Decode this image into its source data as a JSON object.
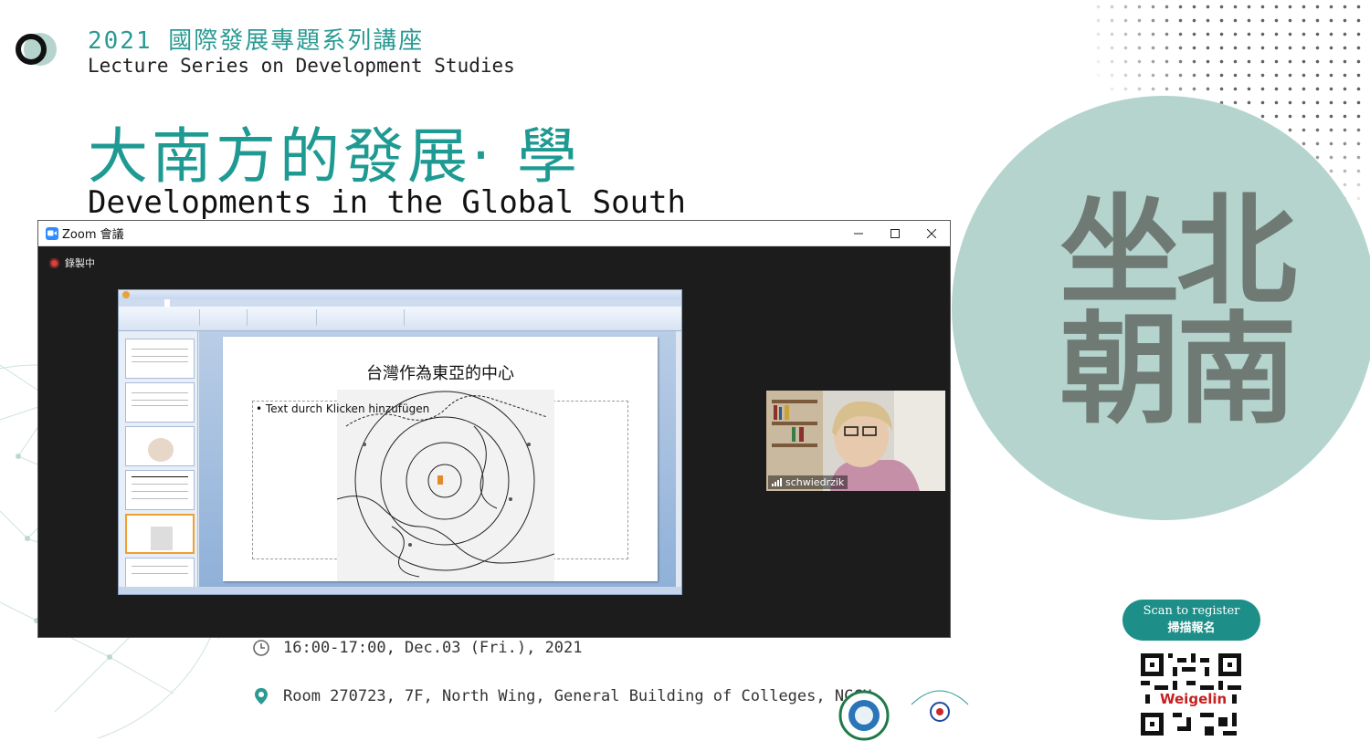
{
  "poster": {
    "series_cn": "2021 國際發展專題系列講座",
    "series_en": "Lecture Series on Development Studies",
    "title_cn": "大南方的發展‧ 學",
    "title_en": "Developments in the Global South",
    "side_calligraphy": [
      "坐北",
      "朝南"
    ],
    "time": "16:00-17:00, Dec.03 (Fri.), 2021",
    "location": "Room 270723, 7F, North Wing, General Building of Colleges, NCCU",
    "scan_en": "Scan to register",
    "scan_cn": "掃描報名",
    "qr_label": "Weigelin",
    "accent_color": "#1f9a93",
    "circle_color": "#b4d4cd"
  },
  "zoom": {
    "window_title": "Zoom 會議",
    "recording_label": "錄製中",
    "participant_name": "schwiedrzik"
  },
  "slide": {
    "title": "台灣作為東亞的中心",
    "bullet": "Text durch Klicken hinzufügen"
  }
}
